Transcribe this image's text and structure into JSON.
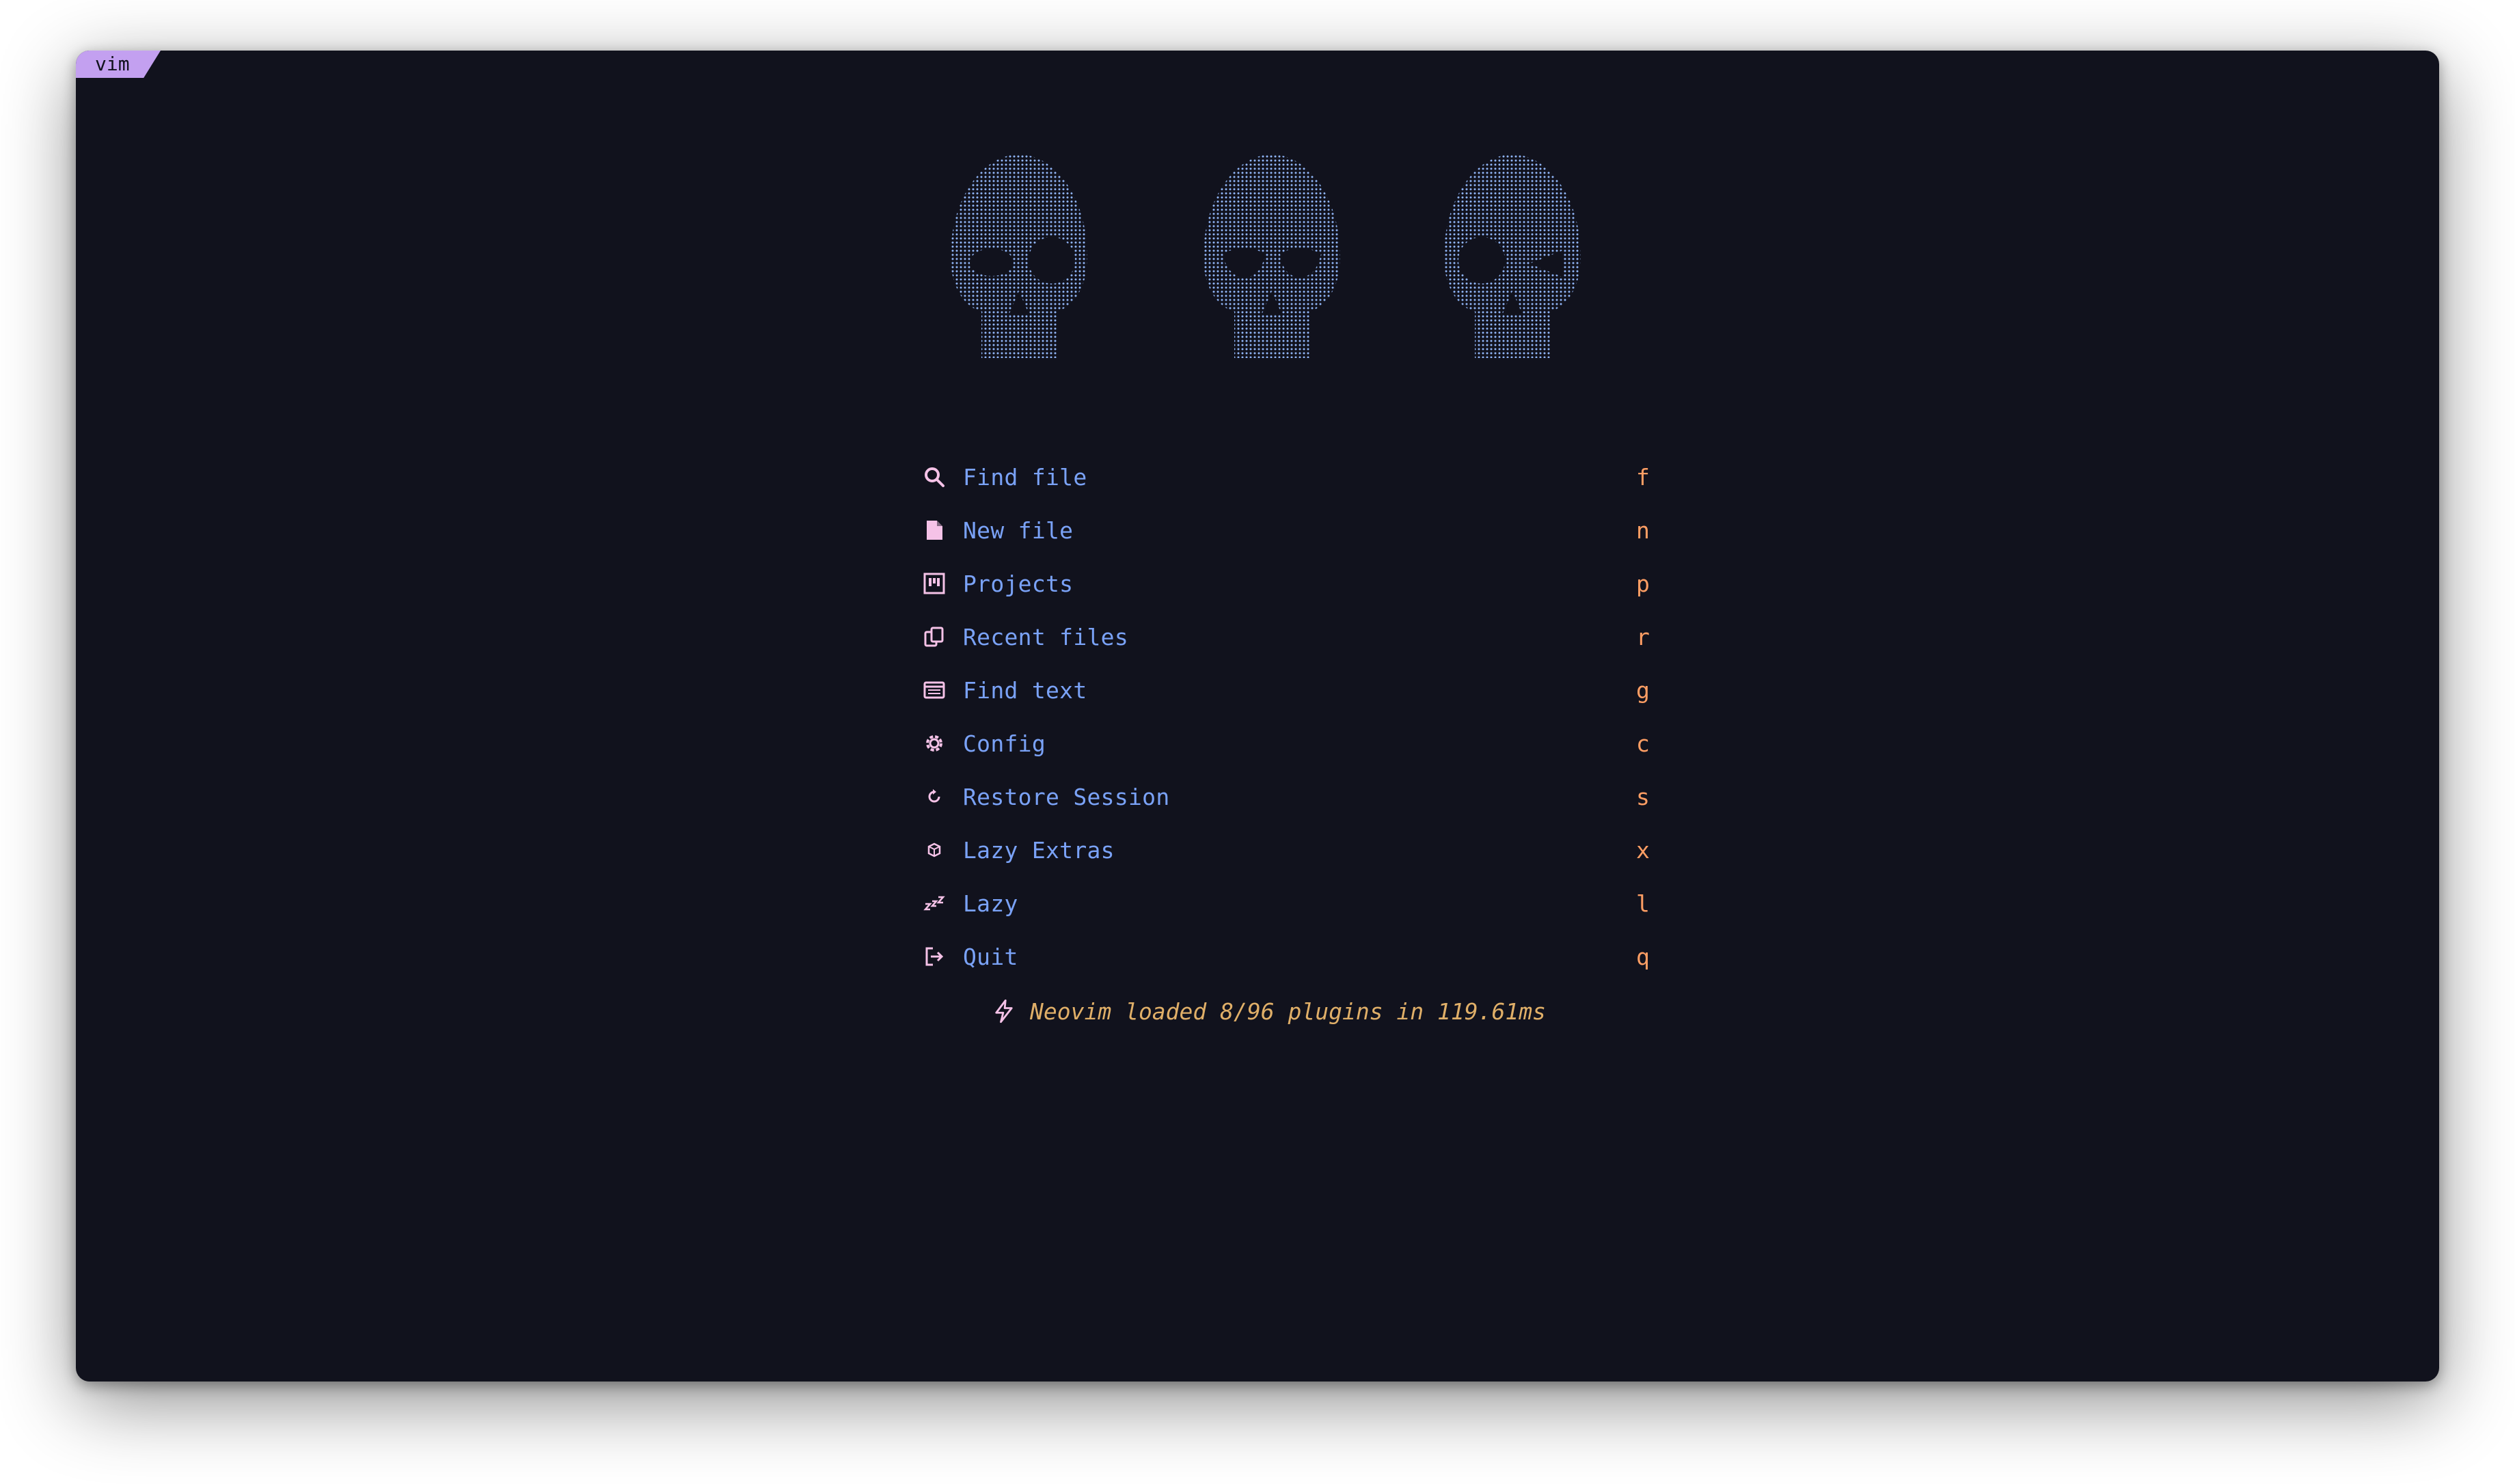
{
  "window": {
    "tab_label": "vim"
  },
  "menu": [
    {
      "label": "Find file",
      "key": "f",
      "icon": "search-icon"
    },
    {
      "label": "New file",
      "key": "n",
      "icon": "file-icon"
    },
    {
      "label": "Projects",
      "key": "p",
      "icon": "projects-icon"
    },
    {
      "label": "Recent files",
      "key": "r",
      "icon": "recent-files-icon"
    },
    {
      "label": "Find text",
      "key": "g",
      "icon": "find-text-icon"
    },
    {
      "label": "Config",
      "key": "c",
      "icon": "gear-icon"
    },
    {
      "label": "Restore Session",
      "key": "s",
      "icon": "restore-icon"
    },
    {
      "label": "Lazy Extras",
      "key": "x",
      "icon": "cube-icon"
    },
    {
      "label": "Lazy",
      "key": "l",
      "icon": "sleep-icon"
    },
    {
      "label": "Quit",
      "key": "q",
      "icon": "exit-icon"
    }
  ],
  "footer": {
    "text": "Neovim loaded 8/96 plugins in 119.61ms",
    "icon": "bolt-icon"
  },
  "colors": {
    "background": "#11121d",
    "tab": "#c3a0f0",
    "label": "#7aa2f7",
    "icon": "#f5c2e7",
    "key": "#ff9e64",
    "footer": "#e0af68",
    "art": "#8fb4f5"
  }
}
